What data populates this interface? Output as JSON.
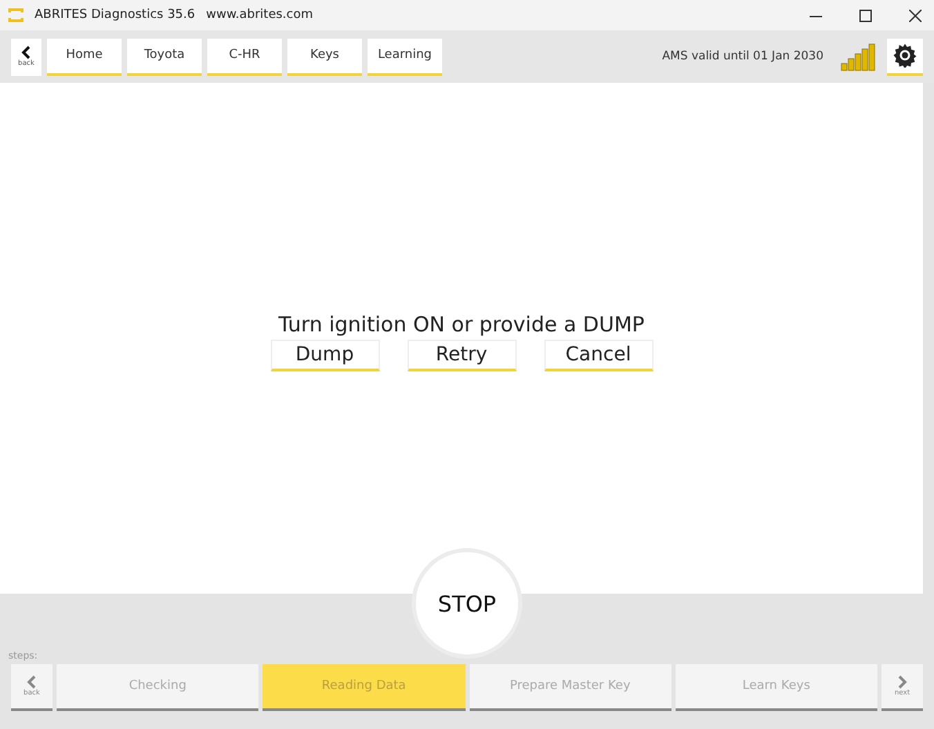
{
  "window": {
    "title": "ABRITES Diagnostics 35.6",
    "url": "www.abrites.com"
  },
  "toolbar": {
    "back_label": "back",
    "tabs": [
      {
        "label": "Home"
      },
      {
        "label": "Toyota"
      },
      {
        "label": "C-HR"
      },
      {
        "label": "Keys"
      },
      {
        "label": "Learning"
      }
    ],
    "license": "AMS valid until 01 Jan 2030"
  },
  "dialog": {
    "message": "Turn ignition ON or provide a DUMP",
    "buttons": [
      "Dump",
      "Retry",
      "Cancel"
    ]
  },
  "stop_button": "STOP",
  "steps": {
    "label": "steps:",
    "back_label": "back",
    "next_label": "next",
    "items": [
      {
        "label": "Checking",
        "selected": false
      },
      {
        "label": "Reading Data",
        "selected": true
      },
      {
        "label": "Prepare Master Key",
        "selected": false
      },
      {
        "label": "Learn Keys",
        "selected": false
      }
    ]
  }
}
